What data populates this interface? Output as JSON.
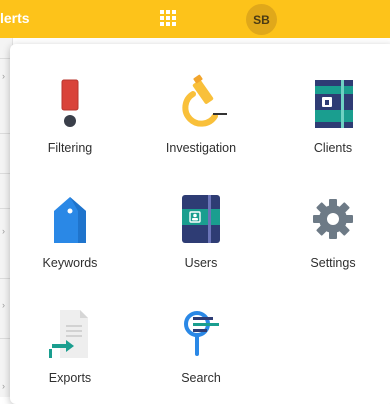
{
  "topbar": {
    "title_partial": "lerts",
    "avatar_initials": "SB"
  },
  "apps": [
    {
      "label": "Filtering",
      "icon": "exclamation-icon"
    },
    {
      "label": "Investigation",
      "icon": "microscope-icon"
    },
    {
      "label": "Clients",
      "icon": "client-book-icon"
    },
    {
      "label": "Keywords",
      "icon": "tag-icon"
    },
    {
      "label": "Users",
      "icon": "user-book-icon"
    },
    {
      "label": "Settings",
      "icon": "gear-icon"
    },
    {
      "label": "Exports",
      "icon": "export-document-icon"
    },
    {
      "label": "Search",
      "icon": "search-icon"
    }
  ],
  "colors": {
    "topbar": "#fdc31a",
    "avatar": "#e0a81a",
    "red": "#d9433a",
    "yellow": "#f9c03a",
    "teal": "#1a9e8f",
    "navy": "#2e3c74",
    "blue": "#2a88e6",
    "gray": "#6d7a86"
  }
}
